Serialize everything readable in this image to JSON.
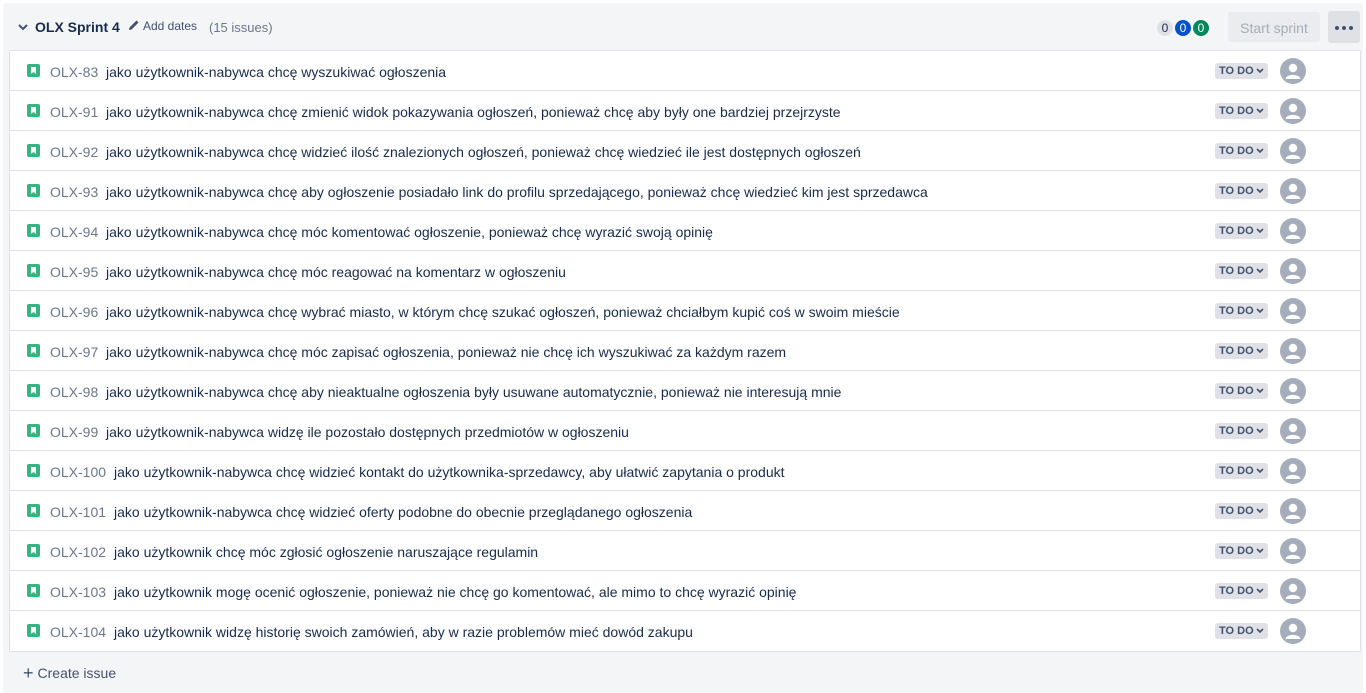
{
  "sprint": {
    "name": "OLX Sprint 4",
    "add_dates": "Add dates",
    "issue_count": "(15 issues)",
    "counts": [
      "0",
      "0",
      "0"
    ],
    "start_sprint": "Start sprint",
    "create_issue": "Create issue"
  },
  "colors": {
    "story_icon": "#36b37e",
    "count_blue": "#0052cc",
    "count_green": "#00875a",
    "status_bg": "#dfe1e6"
  },
  "issues": [
    {
      "key": "OLX-83",
      "summary": "jako użytkownik-nabywca chcę wyszukiwać ogłoszenia",
      "status": "TO DO"
    },
    {
      "key": "OLX-91",
      "summary": "jako użytkownik-nabywca chcę zmienić widok pokazywania ogłoszeń, ponieważ chcę aby były one bardziej przejrzyste",
      "status": "TO DO"
    },
    {
      "key": "OLX-92",
      "summary": "jako użytkownik-nabywca chcę widzieć ilość znalezionych ogłoszeń, ponieważ chcę wiedzieć ile jest dostępnych ogłoszeń",
      "status": "TO DO"
    },
    {
      "key": "OLX-93",
      "summary": "jako użytkownik-nabywca chcę aby ogłoszenie posiadało link do profilu sprzedającego, ponieważ chcę wiedzieć kim jest sprzedawca",
      "status": "TO DO"
    },
    {
      "key": "OLX-94",
      "summary": "jako użytkownik-nabywca chcę móc komentować ogłoszenie, ponieważ chcę wyrazić swoją opinię",
      "status": "TO DO"
    },
    {
      "key": "OLX-95",
      "summary": "jako użytkownik-nabywca chcę móc reagować na komentarz w ogłoszeniu",
      "status": "TO DO"
    },
    {
      "key": "OLX-96",
      "summary": "jako użytkownik-nabywca chcę wybrać miasto, w którym chcę szukać ogłoszeń, ponieważ chciałbym kupić coś w swoim mieście",
      "status": "TO DO"
    },
    {
      "key": "OLX-97",
      "summary": "jako użytkownik-nabywca chcę móc zapisać ogłoszenia, ponieważ nie chcę ich wyszukiwać za każdym razem",
      "status": "TO DO"
    },
    {
      "key": "OLX-98",
      "summary": "jako użytkownik-nabywca chcę aby nieaktualne ogłoszenia były usuwane automatycznie, ponieważ nie interesują mnie",
      "status": "TO DO"
    },
    {
      "key": "OLX-99",
      "summary": "jako użytkownik-nabywca widzę ile pozostało dostępnych przedmiotów w ogłoszeniu",
      "status": "TO DO"
    },
    {
      "key": "OLX-100",
      "summary": "jako użytkownik-nabywca chcę widzieć kontakt do użytkownika-sprzedawcy, aby ułatwić zapytania o produkt",
      "status": "TO DO"
    },
    {
      "key": "OLX-101",
      "summary": "jako użytkownik-nabywca chcę widzieć oferty podobne do obecnie przeglądanego ogłoszenia",
      "status": "TO DO"
    },
    {
      "key": "OLX-102",
      "summary": "jako użytkownik chcę móc zgłosić ogłoszenie naruszające regulamin",
      "status": "TO DO"
    },
    {
      "key": "OLX-103",
      "summary": "jako użytkownik mogę ocenić ogłoszenie, ponieważ nie chcę go komentować, ale mimo to chcę wyrazić opinię",
      "status": "TO DO"
    },
    {
      "key": "OLX-104",
      "summary": "jako użytkownik widzę historię swoich zamówień, aby w razie problemów mieć dowód zakupu",
      "status": "TO DO"
    }
  ]
}
